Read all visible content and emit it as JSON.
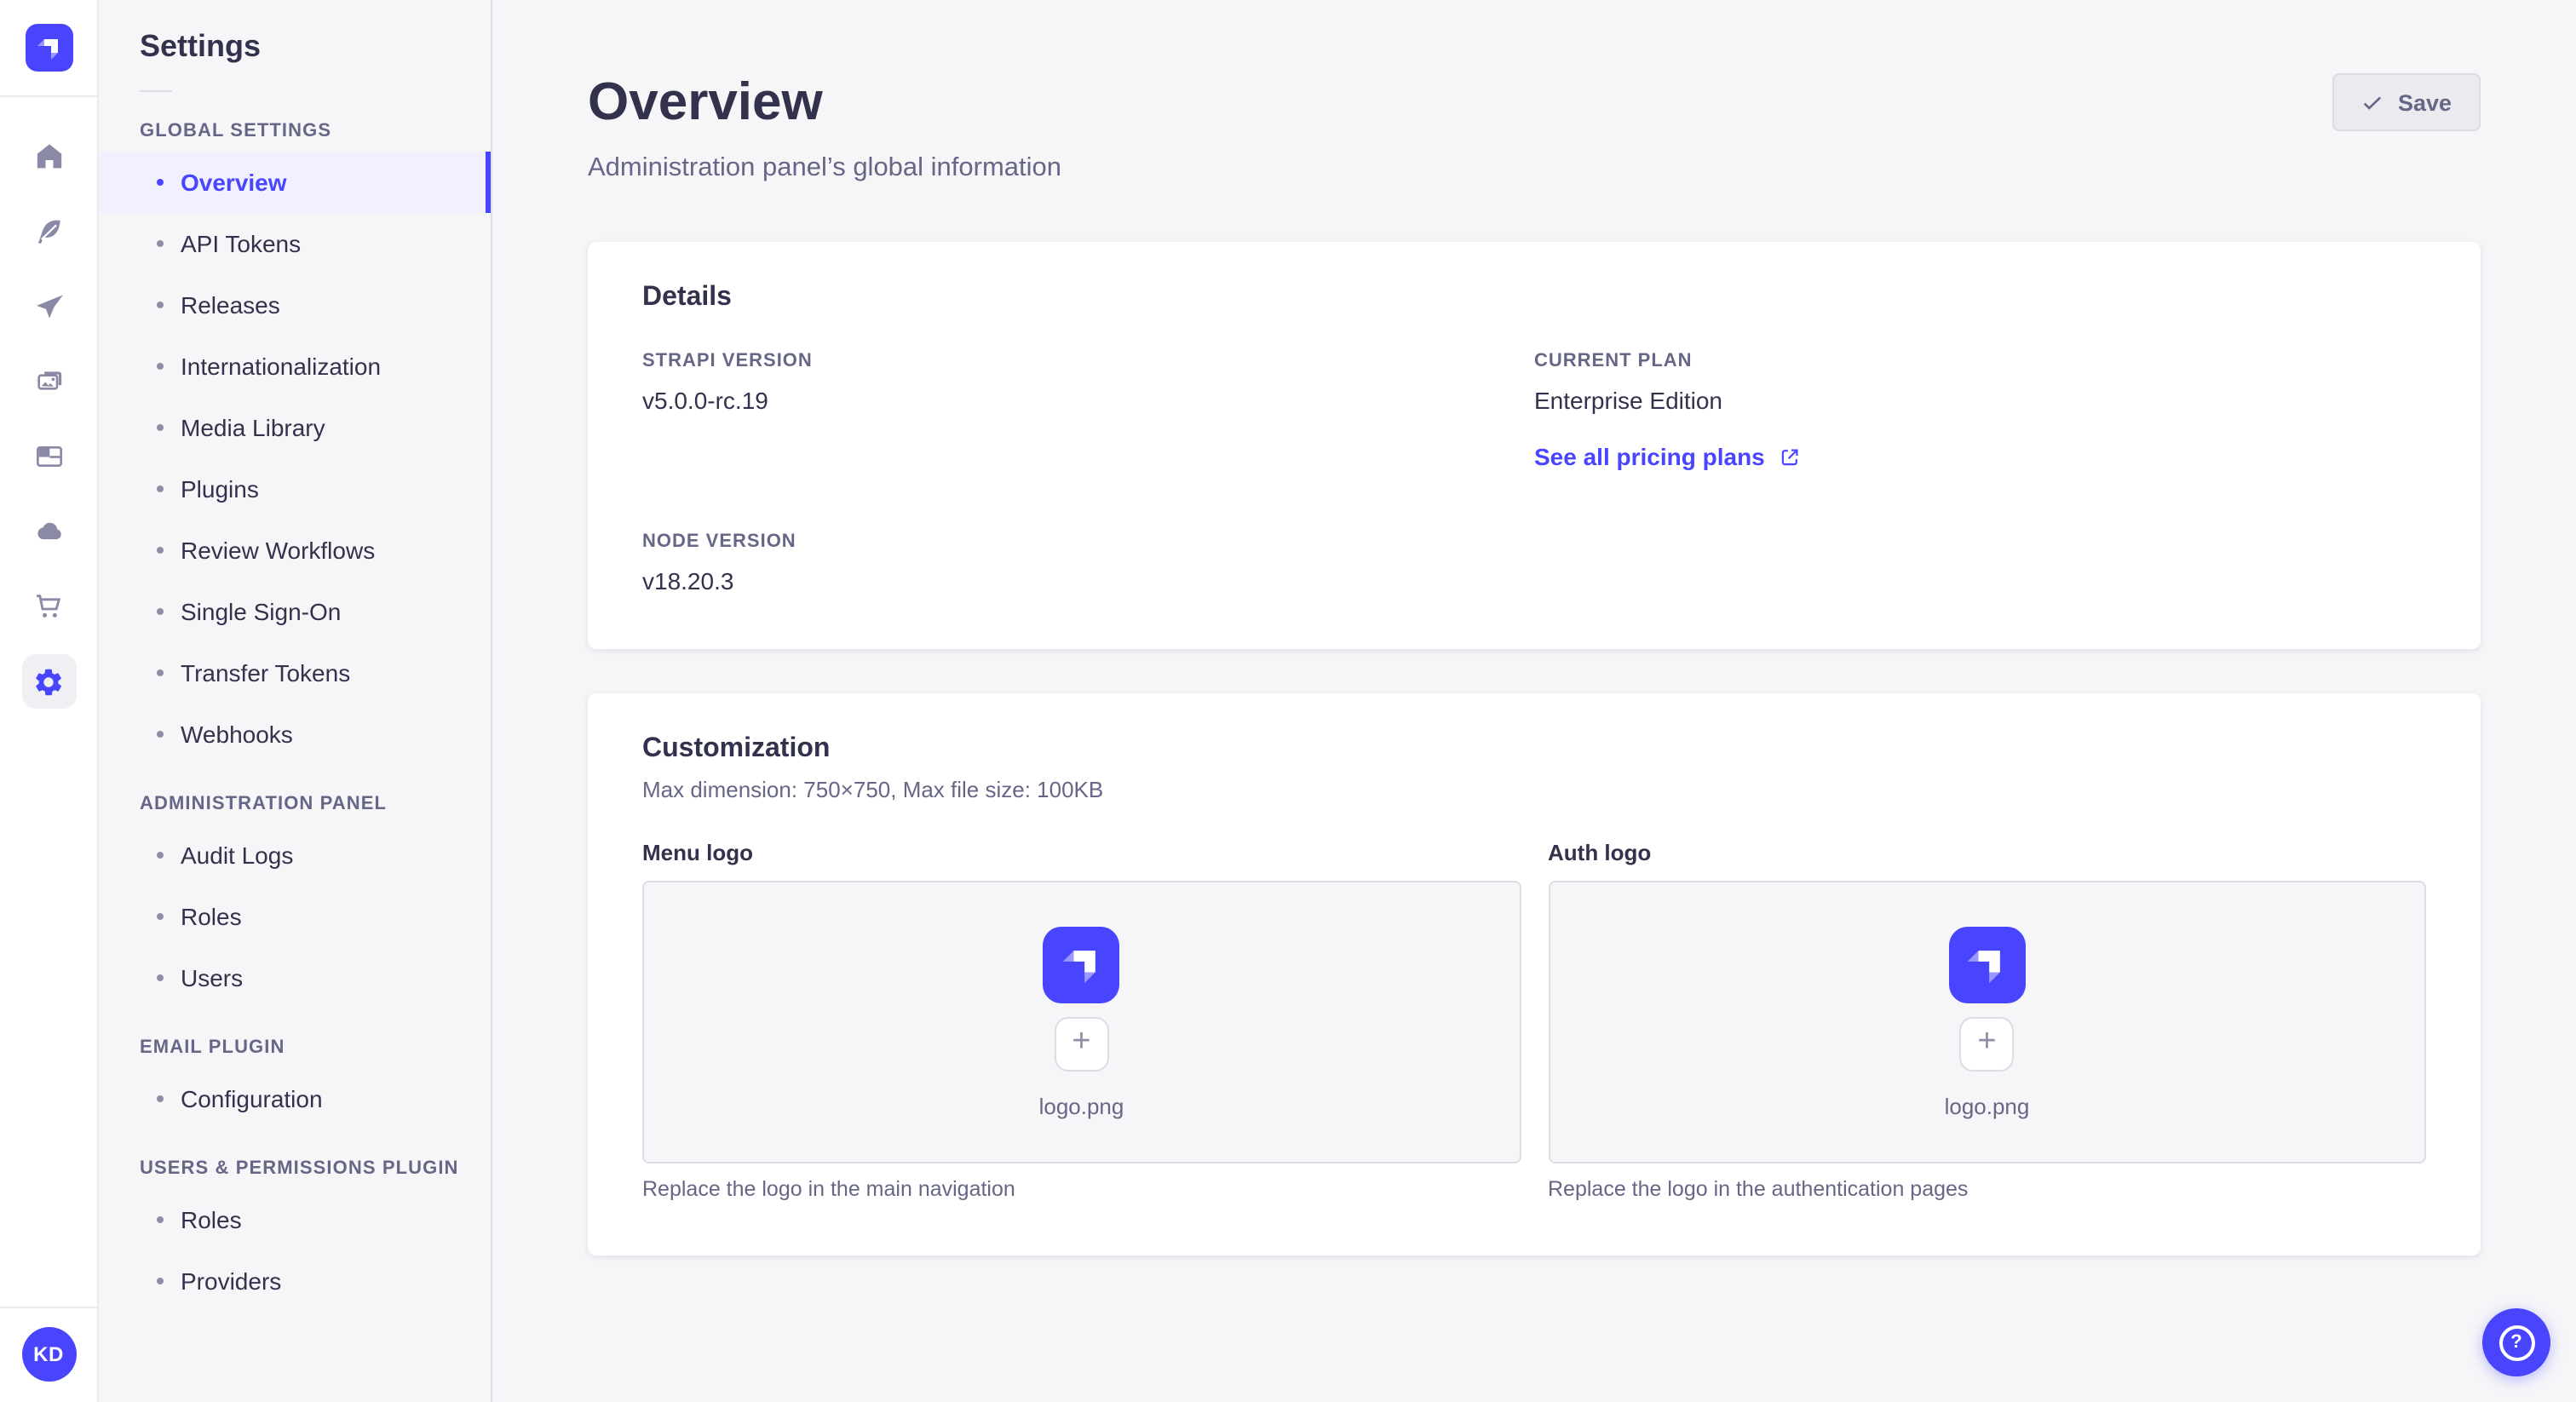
{
  "brand": {
    "primary": "#4945ff",
    "active_bg": "#f0f0ff"
  },
  "rail": {
    "logo_icon": "strapi-logo",
    "icons": [
      "home",
      "feather",
      "paper-plane",
      "images",
      "layout",
      "cloud",
      "cart",
      "gear"
    ],
    "avatar_initials": "KD"
  },
  "subnav": {
    "title": "Settings",
    "sections": [
      {
        "label": "GLOBAL SETTINGS",
        "items": [
          {
            "label": "Overview"
          },
          {
            "label": "API Tokens"
          },
          {
            "label": "Releases"
          },
          {
            "label": "Internationalization"
          },
          {
            "label": "Media Library"
          },
          {
            "label": "Plugins"
          },
          {
            "label": "Review Workflows"
          },
          {
            "label": "Single Sign-On"
          },
          {
            "label": "Transfer Tokens"
          },
          {
            "label": "Webhooks"
          }
        ]
      },
      {
        "label": "ADMINISTRATION PANEL",
        "items": [
          {
            "label": "Audit Logs"
          },
          {
            "label": "Roles"
          },
          {
            "label": "Users"
          }
        ]
      },
      {
        "label": "EMAIL PLUGIN",
        "items": [
          {
            "label": "Configuration"
          }
        ]
      },
      {
        "label": "USERS & PERMISSIONS PLUGIN",
        "items": [
          {
            "label": "Roles"
          },
          {
            "label": "Providers"
          }
        ]
      }
    ]
  },
  "header": {
    "title": "Overview",
    "subtitle": "Administration panel’s global information",
    "save_label": "Save"
  },
  "details": {
    "heading": "Details",
    "strapi_version": {
      "label": "STRAPI VERSION",
      "value": "v5.0.0-rc.19"
    },
    "current_plan": {
      "label": "CURRENT PLAN",
      "value": "Enterprise Edition"
    },
    "node_version": {
      "label": "NODE VERSION",
      "value": "v18.20.3"
    },
    "pricing_link": "See all pricing plans"
  },
  "customization": {
    "heading": "Customization",
    "subheading": "Max dimension: 750×750, Max file size: 100KB",
    "menu_logo": {
      "label": "Menu logo",
      "filename": "logo.png",
      "caption": "Replace the logo in the main navigation"
    },
    "auth_logo": {
      "label": "Auth logo",
      "filename": "logo.png",
      "caption": "Replace the logo in the authentication pages"
    }
  }
}
